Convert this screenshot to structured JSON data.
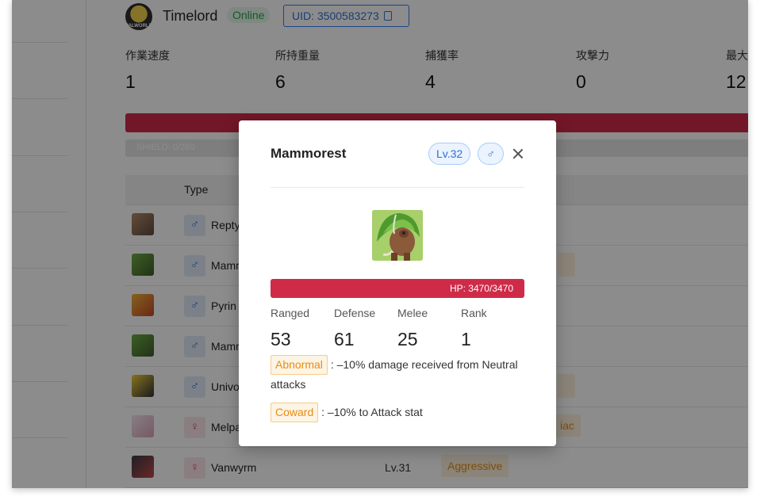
{
  "player": {
    "name": "Timelord",
    "status": "Online",
    "uid_label": "UID: 3500583273",
    "avatar_badge": "PALWORLD"
  },
  "stats": [
    {
      "label": "作業速度",
      "value": "1"
    },
    {
      "label": "所持重量",
      "value": "6"
    },
    {
      "label": "捕獲率",
      "value": "4"
    },
    {
      "label": "攻撃力",
      "value": "0"
    },
    {
      "label": "最大",
      "value": "12"
    }
  ],
  "shield_label": "SHIELD: 0/260",
  "table": {
    "type_header": "Type",
    "rows": [
      {
        "name": "Repty",
        "gender": "♂",
        "gender_type": "male",
        "level": "",
        "trait": ""
      },
      {
        "name": "Mamm",
        "gender": "♂",
        "gender_type": "male",
        "level": "",
        "trait": ""
      },
      {
        "name": "Pyrin",
        "gender": "♂",
        "gender_type": "male",
        "level": "",
        "trait": ""
      },
      {
        "name": "Mamm",
        "gender": "♂",
        "gender_type": "male",
        "level": "",
        "trait": ""
      },
      {
        "name": "Univo",
        "gender": "♂",
        "gender_type": "male",
        "level": "",
        "trait": ""
      },
      {
        "name": "Melpa",
        "gender": "♀",
        "gender_type": "female",
        "level": "",
        "trait": "iac"
      },
      {
        "name": "Vanwyrm",
        "gender": "♀",
        "gender_type": "female",
        "level": "Lv.31",
        "trait": "Aggressive"
      }
    ]
  },
  "modal": {
    "title": "Mammorest",
    "level_badge": "Lv.32",
    "gender_badge": "♂",
    "hp_label": "HP: 3470/3470",
    "stats": [
      {
        "label": "Ranged",
        "value": "53"
      },
      {
        "label": "Defense",
        "value": "61"
      },
      {
        "label": "Melee",
        "value": "25"
      },
      {
        "label": "Rank",
        "value": "1"
      }
    ],
    "traits": [
      {
        "name": "Abnormal",
        "desc": ": –10% damage received from Neutral attacks"
      },
      {
        "name": "Coward",
        "desc": ": –10% to Attack stat"
      }
    ]
  },
  "colors": {
    "hp_bar": "#cf2b48",
    "accent_blue": "#2f6fd8",
    "online_green": "#2f9e4e",
    "trait_orange": "#e88d15"
  }
}
